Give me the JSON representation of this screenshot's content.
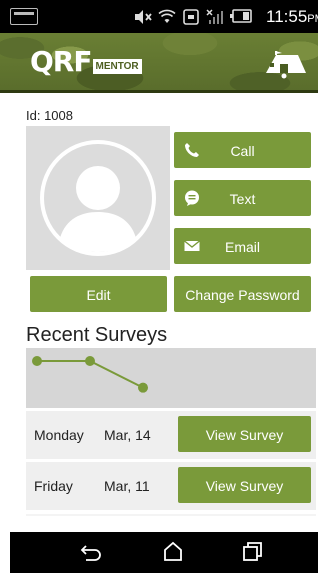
{
  "status_bar": {
    "time": "11:55",
    "time_suffix": "PM",
    "icons": [
      "mute-icon",
      "wifi-icon",
      "nfc-icon",
      "no-signal-icon",
      "battery-icon"
    ]
  },
  "header": {
    "logo_text": "QRF",
    "logo_subtext": "MENTOR",
    "right_icon": "hq-tent-icon"
  },
  "profile": {
    "id_label": "Id: 1008",
    "avatar_icon": "default-avatar-icon"
  },
  "actions": {
    "call_label": "Call",
    "text_label": "Text",
    "email_label": "Email",
    "edit_label": "Edit",
    "change_password_label": "Change Password"
  },
  "surveys": {
    "title": "Recent Surveys",
    "trend_color": "#7a9a3a",
    "trend_points": [
      3,
      3,
      1
    ],
    "items": [
      {
        "day": "Monday",
        "date": "Mar, 14",
        "action": "View Survey"
      },
      {
        "day": "Friday",
        "date": "Mar, 11",
        "action": "View Survey"
      }
    ]
  },
  "colors": {
    "accent": "#7a9a3a",
    "status_bar": "#000000"
  }
}
